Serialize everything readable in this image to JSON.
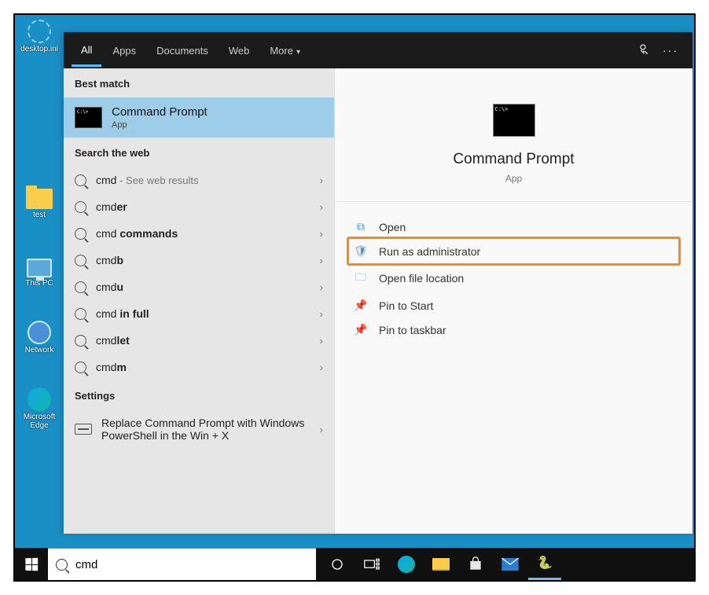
{
  "desktop_icons": [
    {
      "label": "desktop.ini",
      "type": "gear"
    },
    {
      "label": "test",
      "type": "folder"
    },
    {
      "label": "This PC",
      "type": "thispc"
    },
    {
      "label": "Network",
      "type": "net"
    },
    {
      "label": "Microsoft Edge",
      "type": "edge"
    }
  ],
  "tabs": {
    "all": "All",
    "apps": "Apps",
    "documents": "Documents",
    "web": "Web",
    "more": "More"
  },
  "sections": {
    "best_match": "Best match",
    "search_web": "Search the web",
    "settings": "Settings"
  },
  "best_match": {
    "title": "Command Prompt",
    "subtitle": "App"
  },
  "web_results": [
    {
      "prefix": "cmd",
      "bold": "",
      "sub": " - See web results"
    },
    {
      "prefix": "cmd",
      "bold": "er",
      "sub": ""
    },
    {
      "prefix": "cmd ",
      "bold": "commands",
      "sub": ""
    },
    {
      "prefix": "cmd",
      "bold": "b",
      "sub": ""
    },
    {
      "prefix": "cmd",
      "bold": "u",
      "sub": ""
    },
    {
      "prefix": "cmd ",
      "bold": "in full",
      "sub": ""
    },
    {
      "prefix": "cmd",
      "bold": "let",
      "sub": ""
    },
    {
      "prefix": "cmd",
      "bold": "m",
      "sub": ""
    }
  ],
  "settings_result": "Replace Command Prompt with Windows PowerShell in the Win + X",
  "preview": {
    "title": "Command Prompt",
    "subtitle": "App"
  },
  "actions": {
    "open": "Open",
    "run_admin": "Run as administrator",
    "open_loc": "Open file location",
    "pin_start": "Pin to Start",
    "pin_taskbar": "Pin to taskbar"
  },
  "search": {
    "query": "cmd"
  }
}
